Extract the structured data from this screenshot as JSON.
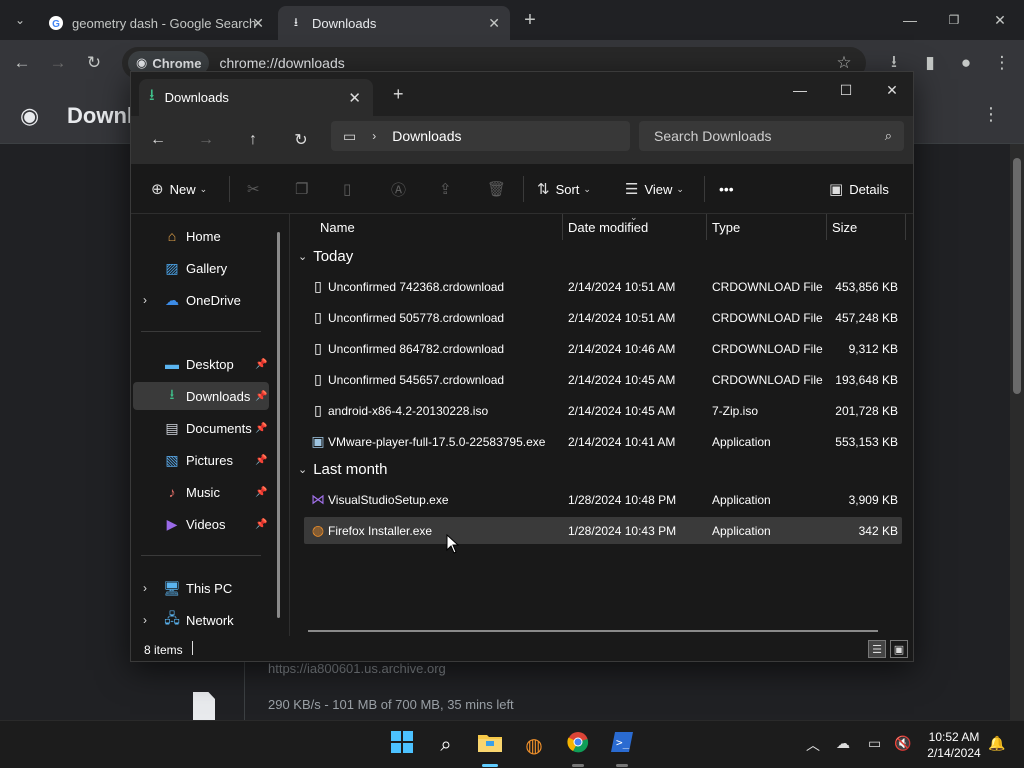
{
  "chrome": {
    "tabs": [
      {
        "title": "geometry dash - Google Search",
        "favicon": "google-g-icon"
      },
      {
        "title": "Downloads",
        "favicon": "download-icon"
      }
    ],
    "new_tab": "+",
    "omnibox_chip": "Chrome",
    "url": "chrome://downloads",
    "page": {
      "title": "Downloads",
      "download_url": "https://ia800601.us.archive.org",
      "download_status": "290 KB/s - 101 MB of 700 MB, 35 mins left"
    }
  },
  "explorer": {
    "tab_title": "Downloads",
    "new_tab": "+",
    "address_segment": "Downloads",
    "search_placeholder": "Search Downloads",
    "commands": {
      "new": "New",
      "sort": "Sort",
      "view": "View",
      "more": "•••",
      "details": "Details"
    },
    "nav": {
      "quick": [
        {
          "label": "Home",
          "icon": "home-icon",
          "color": "#e8a64a"
        },
        {
          "label": "Gallery",
          "icon": "gallery-icon",
          "color": "#4aa3e8"
        },
        {
          "label": "OneDrive",
          "icon": "cloud-icon",
          "color": "#3c8ce7"
        }
      ],
      "pinned": [
        {
          "label": "Desktop",
          "icon": "desktop-icon",
          "color": "#5ab4f0"
        },
        {
          "label": "Downloads",
          "icon": "download-icon",
          "color": "#3fbf8a"
        },
        {
          "label": "Documents",
          "icon": "document-icon",
          "color": "#d0d4dc"
        },
        {
          "label": "Pictures",
          "icon": "picture-icon",
          "color": "#58a8e8"
        },
        {
          "label": "Music",
          "icon": "music-icon",
          "color": "#e8716a"
        },
        {
          "label": "Videos",
          "icon": "video-icon",
          "color": "#9a6ae8"
        }
      ],
      "devices": [
        {
          "label": "This PC",
          "icon": "computer-icon",
          "color": "#5ab4f0"
        },
        {
          "label": "Network",
          "icon": "network-icon",
          "color": "#5ab4f0"
        }
      ]
    },
    "columns": {
      "name": "Name",
      "date": "Date modified",
      "type": "Type",
      "size": "Size"
    },
    "groups": [
      {
        "label": "Today",
        "files": [
          {
            "name": "Unconfirmed 742368.crdownload",
            "date": "2/14/2024 10:51 AM",
            "type": "CRDOWNLOAD File",
            "size": "453,856 KB",
            "icon": "file-icon"
          },
          {
            "name": "Unconfirmed 505778.crdownload",
            "date": "2/14/2024 10:51 AM",
            "type": "CRDOWNLOAD File",
            "size": "457,248 KB",
            "icon": "file-icon"
          },
          {
            "name": "Unconfirmed 864782.crdownload",
            "date": "2/14/2024 10:46 AM",
            "type": "CRDOWNLOAD File",
            "size": "9,312 KB",
            "icon": "file-icon"
          },
          {
            "name": "Unconfirmed 545657.crdownload",
            "date": "2/14/2024 10:45 AM",
            "type": "CRDOWNLOAD File",
            "size": "193,648 KB",
            "icon": "file-icon"
          },
          {
            "name": "android-x86-4.2-20130228.iso",
            "date": "2/14/2024 10:45 AM",
            "type": "7-Zip.iso",
            "size": "201,728 KB",
            "icon": "file-icon"
          },
          {
            "name": "VMware-player-full-17.5.0-22583795.exe",
            "date": "2/14/2024 10:41 AM",
            "type": "Application",
            "size": "553,153 KB",
            "icon": "installer-icon"
          }
        ]
      },
      {
        "label": "Last month",
        "files": [
          {
            "name": "VisualStudioSetup.exe",
            "date": "1/28/2024 10:48 PM",
            "type": "Application",
            "size": "3,909 KB",
            "icon": "visual-studio-icon"
          },
          {
            "name": "Firefox Installer.exe",
            "date": "1/28/2024 10:43 PM",
            "type": "Application",
            "size": "342 KB",
            "icon": "firefox-icon"
          }
        ]
      }
    ],
    "status": "8 items"
  },
  "taskbar": {
    "time": "10:52 AM",
    "date": "2/14/2024"
  }
}
